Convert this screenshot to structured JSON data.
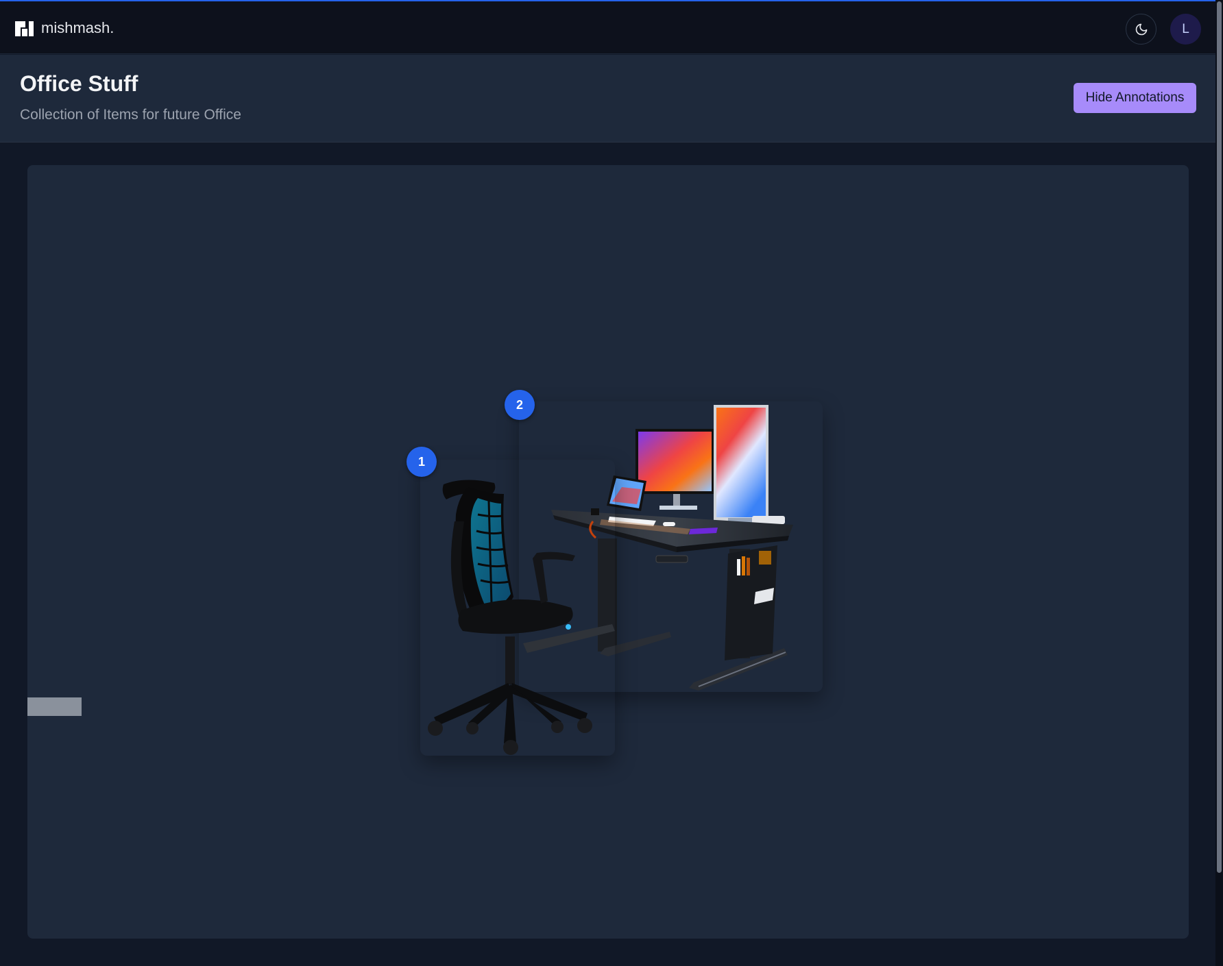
{
  "app": {
    "name": "mishmash."
  },
  "header": {
    "title": "Office Stuff",
    "subtitle": "Collection of Items for future Office",
    "hide_annotations_label": "Hide Annotations"
  },
  "user": {
    "avatar_initial": "L"
  },
  "annotations": [
    {
      "number": "1",
      "item": "office-chair"
    },
    {
      "number": "2",
      "item": "standing-desk"
    }
  ],
  "colors": {
    "accent": "#2563eb",
    "button": "#a78bfa",
    "nav_bg": "#0d111c",
    "canvas_bg": "#1e293b"
  },
  "icons": [
    "logo-icon",
    "moon-icon"
  ]
}
